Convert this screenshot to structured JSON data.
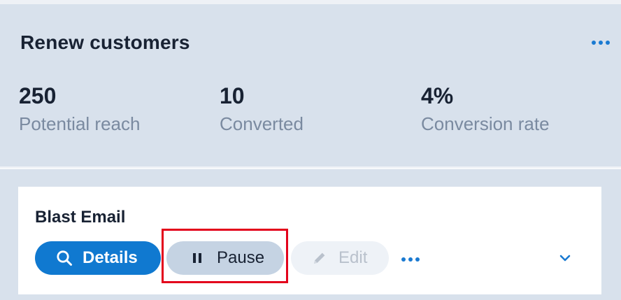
{
  "summary": {
    "title": "Renew customers",
    "stats": [
      {
        "value": "250",
        "label": "Potential reach"
      },
      {
        "value": "10",
        "label": "Converted"
      },
      {
        "value": "4%",
        "label": "Conversion rate"
      }
    ]
  },
  "card": {
    "title": "Blast Email",
    "buttons": {
      "details": "Details",
      "pause": "Pause",
      "edit": "Edit"
    }
  },
  "icons": {
    "summary_more": "more-horizontal-icon",
    "details": "search-icon",
    "pause": "pause-icon",
    "edit": "pencil-icon",
    "actions_more": "more-horizontal-icon",
    "expand": "chevron-down-icon"
  },
  "colors": {
    "accent": "#1079d0",
    "panel_background": "#d8e1ec",
    "card_background": "#ffffff",
    "secondary_button": "#c5d3e3",
    "disabled_button": "#eef2f7",
    "highlight_box": "#e3001b",
    "heading_text": "#182233",
    "muted_text": "#7a8aa0"
  }
}
